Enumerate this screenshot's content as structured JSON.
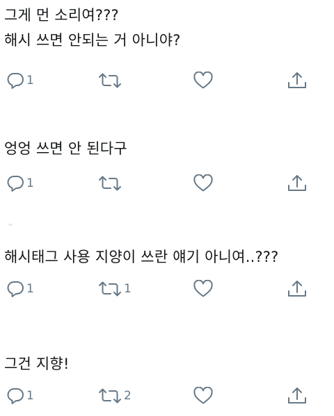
{
  "tweets": [
    {
      "lines": [
        "그게 먼 소리여???",
        "해시 쓰면 안되는 거 아니야?"
      ],
      "reply_count": "1",
      "retweet_count": "",
      "like_count": ""
    },
    {
      "lines": [
        "엉엉 쓰면 안 된다구"
      ],
      "reply_count": "1",
      "retweet_count": "",
      "like_count": ""
    },
    {
      "lines": [
        "해시태그 사용 지양이 쓰란 얘기 아니여..???"
      ],
      "reply_count": "1",
      "retweet_count": "1",
      "like_count": ""
    },
    {
      "lines": [
        "그건 지향!"
      ],
      "reply_count": "1",
      "retweet_count": "2",
      "like_count": ""
    }
  ],
  "icons": {
    "reply": "reply-icon",
    "retweet": "retweet-icon",
    "like": "heart-icon",
    "share": "share-icon"
  },
  "colors": {
    "text": "#14171a",
    "icon": "#657786"
  }
}
